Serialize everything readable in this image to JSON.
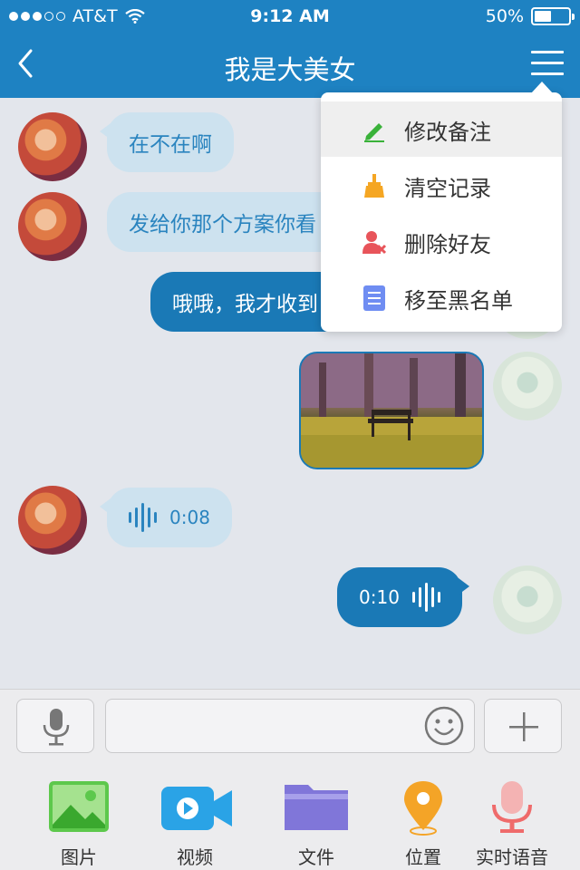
{
  "status_bar": {
    "carrier": "AT&T",
    "time": "9:12 AM",
    "battery": "50%",
    "battery_level": 0.5
  },
  "header": {
    "title": "我是大美女"
  },
  "messages": [
    {
      "side": "in",
      "type": "text",
      "text": "在不在啊"
    },
    {
      "side": "in",
      "type": "text",
      "text": "发给你那个方案你看"
    },
    {
      "side": "out",
      "type": "text",
      "text": "哦哦，我才收到"
    },
    {
      "side": "out",
      "type": "image"
    },
    {
      "side": "in",
      "type": "voice",
      "duration": "0:08"
    },
    {
      "side": "out",
      "type": "voice",
      "duration": "0:10"
    }
  ],
  "dropdown": {
    "items": [
      {
        "label": "修改备注",
        "icon": "pencil-icon",
        "color": "#3ab23a"
      },
      {
        "label": "清空记录",
        "icon": "broom-icon",
        "color": "#f5a623"
      },
      {
        "label": "删除好友",
        "icon": "delete-user-icon",
        "color": "#e8545a"
      },
      {
        "label": "移至黑名单",
        "icon": "list-icon",
        "color": "#6f8df2"
      }
    ]
  },
  "toolbar": {
    "items": [
      {
        "label": "图片",
        "icon": "picture-icon",
        "color": "#5dc84c"
      },
      {
        "label": "视频",
        "icon": "video-icon",
        "color": "#2aa3e6"
      },
      {
        "label": "文件",
        "icon": "folder-icon",
        "color": "#8076d9"
      },
      {
        "label": "位置",
        "icon": "location-icon",
        "color": "#f4a427"
      },
      {
        "label": "实时语音",
        "icon": "microphone-icon",
        "color": "#ef6b6b"
      }
    ]
  }
}
